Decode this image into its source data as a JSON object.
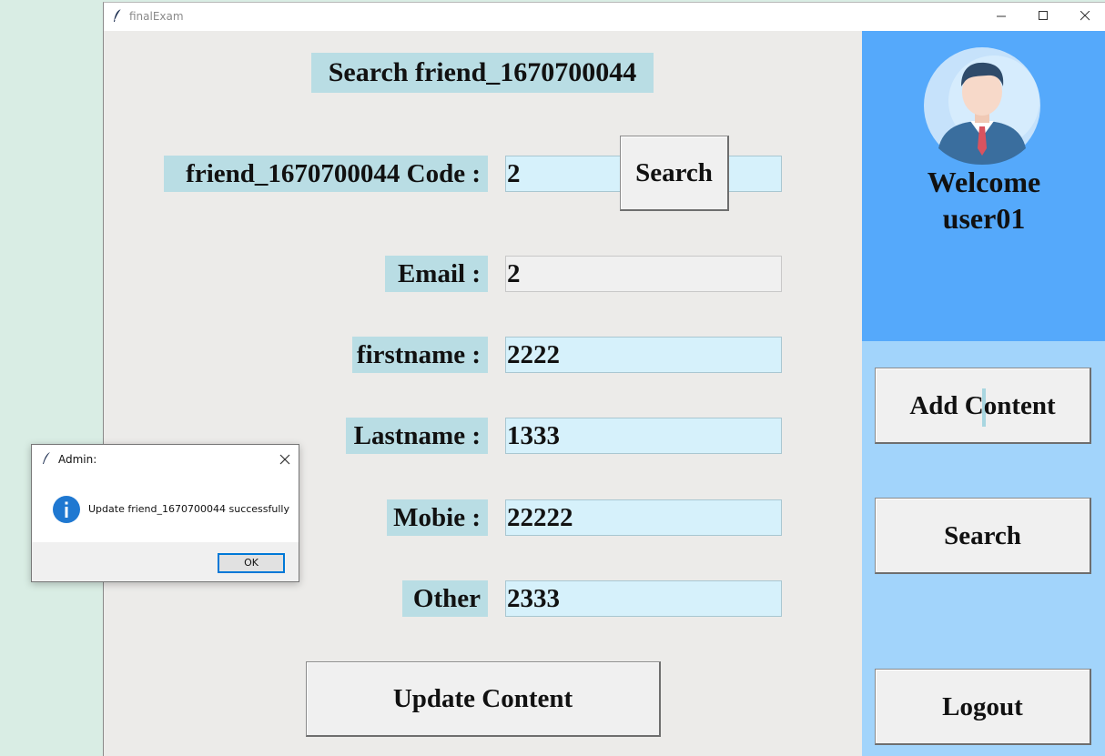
{
  "window": {
    "title": "finalExam"
  },
  "form": {
    "heading": "Search friend_1670700044",
    "code_label": "friend_1670700044 Code :",
    "code_value": "2",
    "search_button": "Search",
    "email_label": "Email :",
    "email_value": "2",
    "firstname_label": "firstname :",
    "firstname_value": "2222",
    "lastname_label": "Lastname :",
    "lastname_value": "1333",
    "mobie_label": "Mobie :",
    "mobie_value": "22222",
    "other_label": "Other",
    "other_value": "2333",
    "update_button": "Update Content"
  },
  "sidebar": {
    "welcome_line1": "Welcome",
    "welcome_line2": "user01",
    "add_content_part1": "Add C",
    "add_content_part2": "ontent",
    "search_button": "Search",
    "logout_button": "Logout",
    "top_color": "#55a9fb",
    "bottom_color": "#a2d4fb"
  },
  "dialog": {
    "title": "Admin:",
    "message": "Update friend_1670700044 successfully",
    "ok_button": "OK",
    "icon": "info-icon"
  },
  "colors": {
    "label_bg": "#b9dde4",
    "entry_bg": "#d6f1fb",
    "content_bg": "#ecebe9"
  }
}
